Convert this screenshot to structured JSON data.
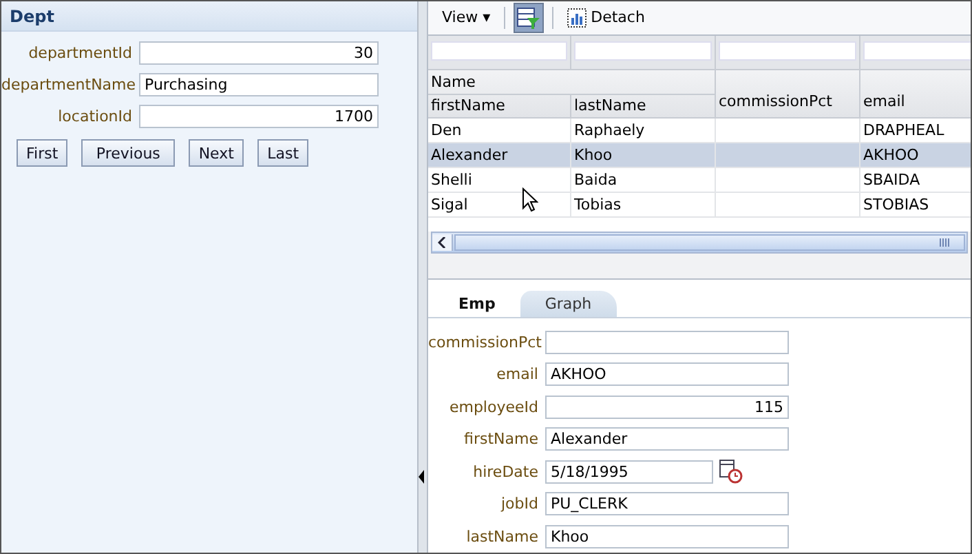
{
  "dept": {
    "title": "Dept",
    "fields": [
      {
        "label": "departmentId",
        "value": "30",
        "kind": "number"
      },
      {
        "label": "departmentName",
        "value": "Purchasing",
        "kind": "text"
      },
      {
        "label": "locationId",
        "value": "1700",
        "kind": "number"
      }
    ],
    "buttons": [
      "First",
      "Previous",
      "Next",
      "Last"
    ]
  },
  "toolbar": {
    "view": "View ▾",
    "detach": "Detach"
  },
  "table": {
    "group": "Name",
    "columns": [
      "firstName",
      "lastName",
      "commissionPct",
      "email"
    ],
    "rows": [
      {
        "cells": [
          "Den",
          "Raphaely",
          null,
          "DRAPHEAL"
        ],
        "selected": false
      },
      {
        "cells": [
          "Alexander",
          "Khoo",
          null,
          "AKHOO"
        ],
        "selected": true
      },
      {
        "cells": [
          "Shelli",
          "Baida",
          null,
          "SBAIDA"
        ],
        "selected": false
      },
      {
        "cells": [
          "Sigal",
          "Tobias",
          null,
          "STOBIAS"
        ],
        "selected": false
      }
    ]
  },
  "tabs": [
    {
      "label": "Emp",
      "selected": true
    },
    {
      "label": "Graph",
      "selected": false
    }
  ],
  "emp": {
    "fields": [
      {
        "label": "commissionPct",
        "kind": "text"
      },
      {
        "label": "email",
        "value": "AKHOO",
        "kind": "text"
      },
      {
        "label": "employeeId",
        "value": "115",
        "kind": "number"
      },
      {
        "label": "firstName",
        "value": "Alexander",
        "kind": "text"
      },
      {
        "label": "hireDate",
        "value": "5/18/1995",
        "kind": "date"
      },
      {
        "label": "jobId",
        "value": "PU_CLERK",
        "kind": "text"
      },
      {
        "label": "lastName",
        "value": "Khoo",
        "kind": "text"
      }
    ]
  }
}
